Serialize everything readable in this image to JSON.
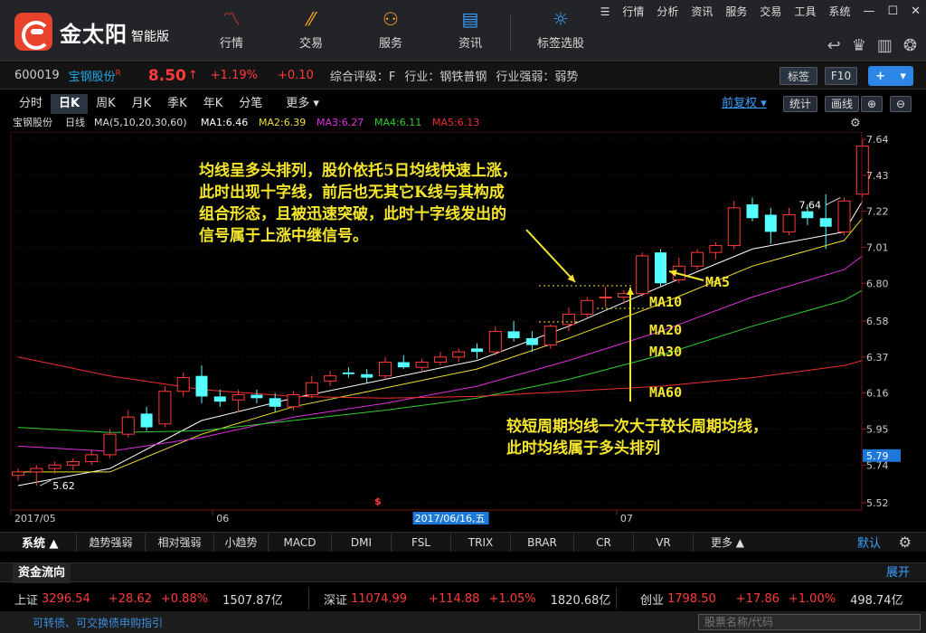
{
  "app": {
    "name": "金太阳",
    "edition": "智能版",
    "nav": [
      {
        "label": "行情",
        "icon": "chart-line-icon"
      },
      {
        "label": "交易",
        "icon": "trade-icon"
      },
      {
        "label": "服务",
        "icon": "user-icon"
      },
      {
        "label": "资讯",
        "icon": "news-icon"
      },
      {
        "label": "标签选股",
        "icon": "bulb-icon"
      }
    ],
    "sysmenu": [
      "行情",
      "分析",
      "资讯",
      "服务",
      "交易",
      "工具",
      "系统"
    ]
  },
  "quote": {
    "code": "600019",
    "name": "宝钢股份",
    "name_mark": "R",
    "price": "8.50",
    "pct": "+1.19%",
    "change": "+0.10",
    "rating": "综合评级：F",
    "industry": "行业：钢铁普钢",
    "industry_strength": "行业强弱：弱势",
    "btn_tag": "标签",
    "btn_f10": "F10"
  },
  "periods": {
    "tabs": [
      "分时",
      "日K",
      "周K",
      "月K",
      "季K",
      "年K",
      "分笔",
      "更多 ▾"
    ],
    "active": "日K",
    "fuquan": "前复权 ▾",
    "tools": [
      "统计",
      "画线"
    ]
  },
  "ma_legend": {
    "stock": "宝钢股份",
    "period": "日线",
    "params": "MA(5,10,20,30,60)",
    "items": [
      {
        "label": "MA1:6.46",
        "color": "#ffffff"
      },
      {
        "label": "MA2:6.39",
        "color": "#f0e030"
      },
      {
        "label": "MA3:6.27",
        "color": "#e030e0"
      },
      {
        "label": "MA4:6.11",
        "color": "#30d030"
      },
      {
        "label": "MA5:6.13",
        "color": "#f03030"
      }
    ]
  },
  "annotations": {
    "top_lines": [
      "均线呈多头排列，股价依托5日均线快速上涨，",
      "此时出现十字线，前后也无其它K线与其构成",
      "组合形态，且被迅速突破，此时十字线发出的",
      "信号属于上涨中继信号。"
    ],
    "bottom_lines": [
      "较短周期均线一次大于较长周期均线，",
      "此时均线属于多头排列"
    ],
    "ma_labels": [
      "MA5",
      "MA10",
      "MA20",
      "MA30",
      "MA60"
    ],
    "text_color": "#f5e62c"
  },
  "chart_data": {
    "type": "candlestick",
    "y_ticks": [
      "7.64",
      "7.43",
      "7.22",
      "7.01",
      "6.80",
      "6.58",
      "6.37",
      "6.16",
      "5.95",
      "5.74",
      "5.52"
    ],
    "ylim": [
      5.52,
      7.64
    ],
    "x_labels": [
      {
        "label": "2017/05",
        "index": 0
      },
      {
        "label": "06",
        "index": 11
      },
      {
        "label": "2017/06/16,五",
        "index": 22
      },
      {
        "label": "07",
        "index": 33
      }
    ],
    "highlight_x": "2017/06/16,五",
    "current_price_label": "5.79",
    "high_label": "7.64",
    "low_label": "5.62",
    "high_index": 45,
    "low_index": 1,
    "candles": [
      {
        "o": 5.68,
        "h": 5.72,
        "l": 5.65,
        "c": 5.7
      },
      {
        "o": 5.7,
        "h": 5.74,
        "l": 5.62,
        "c": 5.72
      },
      {
        "o": 5.72,
        "h": 5.76,
        "l": 5.69,
        "c": 5.74
      },
      {
        "o": 5.74,
        "h": 5.78,
        "l": 5.71,
        "c": 5.76
      },
      {
        "o": 5.76,
        "h": 5.83,
        "l": 5.74,
        "c": 5.8
      },
      {
        "o": 5.8,
        "h": 5.95,
        "l": 5.78,
        "c": 5.92
      },
      {
        "o": 5.92,
        "h": 6.06,
        "l": 5.9,
        "c": 6.02
      },
      {
        "o": 6.04,
        "h": 6.08,
        "l": 5.94,
        "c": 5.96
      },
      {
        "o": 5.98,
        "h": 6.2,
        "l": 5.96,
        "c": 6.17
      },
      {
        "o": 6.17,
        "h": 6.28,
        "l": 6.14,
        "c": 6.25
      },
      {
        "o": 6.26,
        "h": 6.32,
        "l": 6.1,
        "c": 6.14
      },
      {
        "o": 6.14,
        "h": 6.18,
        "l": 6.08,
        "c": 6.11
      },
      {
        "o": 6.12,
        "h": 6.18,
        "l": 6.05,
        "c": 6.15
      },
      {
        "o": 6.15,
        "h": 6.18,
        "l": 6.1,
        "c": 6.13
      },
      {
        "o": 6.13,
        "h": 6.16,
        "l": 6.05,
        "c": 6.08
      },
      {
        "o": 6.08,
        "h": 6.17,
        "l": 6.06,
        "c": 6.15
      },
      {
        "o": 6.15,
        "h": 6.26,
        "l": 6.13,
        "c": 6.22
      },
      {
        "o": 6.23,
        "h": 6.29,
        "l": 6.2,
        "c": 6.26
      },
      {
        "o": 6.28,
        "h": 6.31,
        "l": 6.25,
        "c": 6.27
      },
      {
        "o": 6.27,
        "h": 6.3,
        "l": 6.22,
        "c": 6.25
      },
      {
        "o": 6.26,
        "h": 6.37,
        "l": 6.24,
        "c": 6.34
      },
      {
        "o": 6.34,
        "h": 6.38,
        "l": 6.3,
        "c": 6.31
      },
      {
        "o": 6.31,
        "h": 6.36,
        "l": 6.28,
        "c": 6.34
      },
      {
        "o": 6.34,
        "h": 6.4,
        "l": 6.32,
        "c": 6.37
      },
      {
        "o": 6.37,
        "h": 6.42,
        "l": 6.34,
        "c": 6.4
      },
      {
        "o": 6.42,
        "h": 6.45,
        "l": 6.36,
        "c": 6.4
      },
      {
        "o": 6.4,
        "h": 6.55,
        "l": 6.38,
        "c": 6.52
      },
      {
        "o": 6.52,
        "h": 6.58,
        "l": 6.46,
        "c": 6.48
      },
      {
        "o": 6.48,
        "h": 6.52,
        "l": 6.4,
        "c": 6.44
      },
      {
        "o": 6.44,
        "h": 6.56,
        "l": 6.42,
        "c": 6.55
      },
      {
        "o": 6.56,
        "h": 6.66,
        "l": 6.52,
        "c": 6.62
      },
      {
        "o": 6.62,
        "h": 6.72,
        "l": 6.6,
        "c": 6.7
      },
      {
        "o": 6.72,
        "h": 6.78,
        "l": 6.66,
        "c": 6.72
      },
      {
        "o": 6.72,
        "h": 6.76,
        "l": 6.68,
        "c": 6.74
      },
      {
        "o": 6.74,
        "h": 6.98,
        "l": 6.72,
        "c": 6.96
      },
      {
        "o": 6.98,
        "h": 7.0,
        "l": 6.78,
        "c": 6.8
      },
      {
        "o": 6.82,
        "h": 6.95,
        "l": 6.8,
        "c": 6.9
      },
      {
        "o": 6.9,
        "h": 7.0,
        "l": 6.88,
        "c": 6.98
      },
      {
        "o": 6.98,
        "h": 7.04,
        "l": 6.94,
        "c": 7.02
      },
      {
        "o": 7.02,
        "h": 7.28,
        "l": 7.0,
        "c": 7.24
      },
      {
        "o": 7.26,
        "h": 7.3,
        "l": 7.16,
        "c": 7.18
      },
      {
        "o": 7.2,
        "h": 7.24,
        "l": 7.03,
        "c": 7.1
      },
      {
        "o": 7.1,
        "h": 7.24,
        "l": 7.08,
        "c": 7.2
      },
      {
        "o": 7.22,
        "h": 7.26,
        "l": 7.14,
        "c": 7.18
      },
      {
        "o": 7.18,
        "h": 7.32,
        "l": 7.0,
        "c": 7.13
      },
      {
        "o": 7.1,
        "h": 7.3,
        "l": 7.08,
        "c": 7.28
      },
      {
        "o": 7.32,
        "h": 7.64,
        "l": 7.3,
        "c": 7.6
      }
    ],
    "ma_series": [
      {
        "name": "MA1",
        "color": "#ffffff",
        "values": [
          [
            0,
            5.62
          ],
          [
            5,
            5.72
          ],
          [
            10,
            6.0
          ],
          [
            15,
            6.13
          ],
          [
            20,
            6.24
          ],
          [
            25,
            6.35
          ],
          [
            30,
            6.55
          ],
          [
            35,
            6.78
          ],
          [
            40,
            7.0
          ],
          [
            45,
            7.1
          ],
          [
            46,
            7.28
          ]
        ]
      },
      {
        "name": "MA2",
        "color": "#f0e030",
        "values": [
          [
            0,
            5.7
          ],
          [
            5,
            5.7
          ],
          [
            10,
            5.92
          ],
          [
            15,
            6.08
          ],
          [
            20,
            6.19
          ],
          [
            25,
            6.3
          ],
          [
            30,
            6.48
          ],
          [
            35,
            6.68
          ],
          [
            40,
            6.9
          ],
          [
            45,
            7.05
          ],
          [
            46,
            7.18
          ]
        ]
      },
      {
        "name": "MA3",
        "color": "#e030e0",
        "values": [
          [
            0,
            5.85
          ],
          [
            5,
            5.82
          ],
          [
            10,
            5.9
          ],
          [
            15,
            6.02
          ],
          [
            20,
            6.1
          ],
          [
            25,
            6.2
          ],
          [
            30,
            6.35
          ],
          [
            35,
            6.52
          ],
          [
            40,
            6.72
          ],
          [
            45,
            6.88
          ],
          [
            46,
            6.96
          ]
        ]
      },
      {
        "name": "MA4",
        "color": "#30d030",
        "values": [
          [
            0,
            5.96
          ],
          [
            5,
            5.93
          ],
          [
            10,
            5.94
          ],
          [
            15,
            6.0
          ],
          [
            20,
            6.06
          ],
          [
            25,
            6.13
          ],
          [
            30,
            6.24
          ],
          [
            35,
            6.38
          ],
          [
            40,
            6.55
          ],
          [
            45,
            6.7
          ],
          [
            46,
            6.76
          ]
        ]
      },
      {
        "name": "MA5",
        "color": "#f03030",
        "values": [
          [
            0,
            6.37
          ],
          [
            5,
            6.26
          ],
          [
            10,
            6.18
          ],
          [
            15,
            6.14
          ],
          [
            20,
            6.13
          ],
          [
            25,
            6.14
          ],
          [
            30,
            6.17
          ],
          [
            35,
            6.2
          ],
          [
            40,
            6.25
          ],
          [
            45,
            6.32
          ],
          [
            46,
            6.35
          ]
        ]
      }
    ]
  },
  "indicators": {
    "system": "系统 ▲",
    "tabs": [
      "趋势强弱",
      "相对强弱",
      "小趋势",
      "MACD",
      "DMI",
      "FSL",
      "TRIX",
      "BRAR",
      "CR",
      "VR",
      "更多 ▲"
    ],
    "default": "默认"
  },
  "moneyflow": {
    "title": "资金流向",
    "expand": "展开"
  },
  "indices": [
    {
      "name": "上证",
      "value": "3296.54",
      "change": "+28.62",
      "pct": "+0.88%",
      "volume": "1507.87亿"
    },
    {
      "name": "深证",
      "value": "11074.99",
      "change": "+114.88",
      "pct": "+1.05%",
      "volume": "1820.68亿"
    },
    {
      "name": "创业",
      "value": "1798.50",
      "change": "+17.86",
      "pct": "+1.00%",
      "volume": "498.74亿"
    }
  ],
  "status": {
    "link": "可转债、可交换债申购指引",
    "search_placeholder": "股票名称/代码"
  }
}
